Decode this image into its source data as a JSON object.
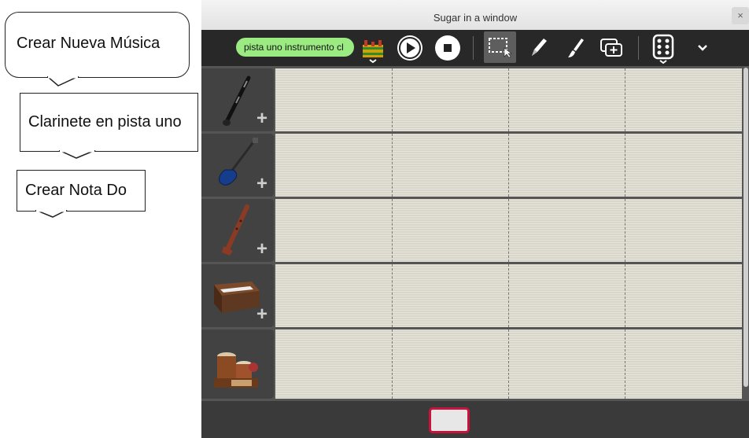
{
  "callouts": [
    {
      "text": "Crear Nueva Música"
    },
    {
      "text": "Clarinete en pista uno"
    },
    {
      "text": "Crear Nota Do"
    }
  ],
  "window": {
    "title": "Sugar in a window",
    "close_label": "×"
  },
  "toolbar": {
    "track_name": "pista uno instrumento cl",
    "buttons": [
      "activity-icon",
      "play-icon",
      "stop-icon",
      "select-icon",
      "pencil-icon",
      "brush-icon",
      "add-layer-icon",
      "dice-icon",
      "expand-icon"
    ]
  },
  "tracks": [
    {
      "instrument": "clarinet",
      "has_add": true
    },
    {
      "instrument": "electric-bass",
      "has_add": true
    },
    {
      "instrument": "recorder",
      "has_add": true
    },
    {
      "instrument": "harmonium",
      "has_add": true
    },
    {
      "instrument": "percussion",
      "has_add": false
    }
  ],
  "plus_label": "+",
  "colors": {
    "accent_green": "#9bea82",
    "stop_key_border": "#c8143c"
  }
}
